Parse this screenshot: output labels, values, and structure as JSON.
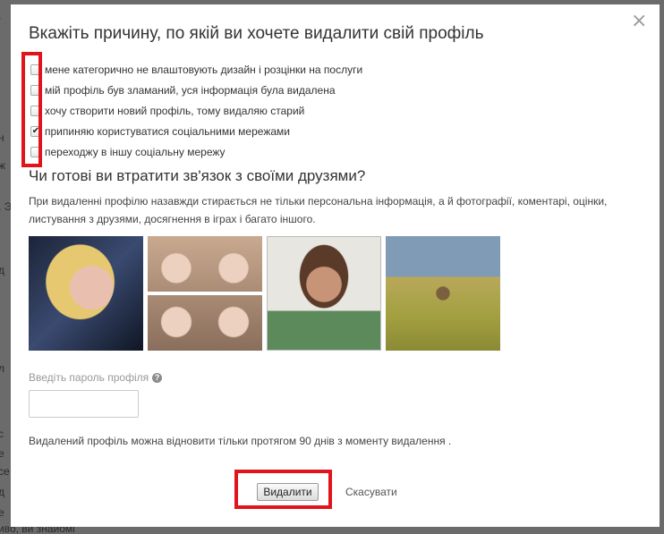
{
  "background": {
    "lines": [
      ",",
      "н",
      "ж",
      ", Э",
      "",
      "д",
      "",
      "",
      "л",
      "",
      "с",
      "е",
      "",
      "се",
      "д",
      "е",
      "",
      "иво, ви знайомі"
    ]
  },
  "dialog": {
    "title": "Вкажіть причину, по якій ви хочете видалити свій профіль",
    "close_icon": "close-icon",
    "reasons": [
      {
        "label": "мене категорично не влаштовують дизайн і розцінки на послуги",
        "checked": false
      },
      {
        "label": "мій профіль був зламаний, уся інформація була видалена",
        "checked": false
      },
      {
        "label": "хочу створити новий профіль, тому видаляю старий",
        "checked": false
      },
      {
        "label": "припиняю користуватися соціальними мережами",
        "checked": true
      },
      {
        "label": "переходжу в іншу соціальну мережу",
        "checked": false
      }
    ],
    "subtitle": "Чи готові ви втратити зв'язок з своїми друзями?",
    "description": "При видаленні профілю назавжди стирається не тільки персональна інформація, а й фотографії, коментарі, оцінки, листування з друзями, досягнення в іграх і багато іншого.",
    "password_label": "Введіть пароль профіля",
    "password_value": "",
    "restore_note": "Видалений профіль можна відновити тільки протягом 90 днів з моменту видалення .",
    "delete_label": "Видалити",
    "cancel_label": "Скасувати",
    "highlight_color": "#e0141a"
  }
}
